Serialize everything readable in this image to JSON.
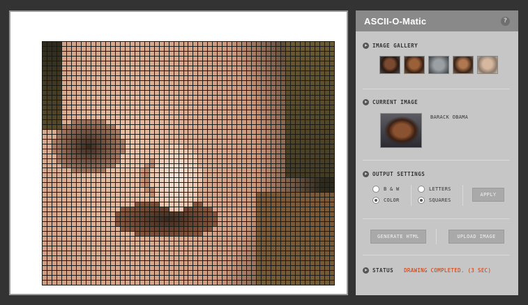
{
  "app": {
    "title": "ASCII-O-Matic",
    "help_label": "?"
  },
  "canvas": {
    "columns": 60,
    "rows": 50,
    "palette": {
      "background": "#1a1a14",
      "skin_light": "#e8c2a8",
      "skin_mid": "#c99479",
      "skin_dark": "#8a5a40",
      "shadow": "#3a2a20",
      "hair_dark": "#2e2a1e",
      "olive": "#6b5a32",
      "highlight": "#f4e6dc"
    }
  },
  "gallery": {
    "title": "IMAGE GALLERY",
    "thumbnails": [
      "thumbnail-1",
      "thumbnail-2",
      "thumbnail-3",
      "thumbnail-4",
      "thumbnail-5"
    ]
  },
  "current": {
    "title": "CURRENT IMAGE",
    "name": "BARACK OBAMA"
  },
  "output": {
    "title": "OUTPUT SETTINGS",
    "options": {
      "bw": "B & W",
      "color": "COLOR",
      "letters": "LETTERS",
      "squares": "SQUARES"
    },
    "selected_mode": "COLOR",
    "selected_style": "SQUARES",
    "apply_label": "APPLY"
  },
  "actions": {
    "generate_label": "GENERATE HTML",
    "upload_label": "UPLOAD IMAGE"
  },
  "status": {
    "title": "STATUS",
    "message": "DRAWING COMPLETED. (3 SEC)"
  }
}
